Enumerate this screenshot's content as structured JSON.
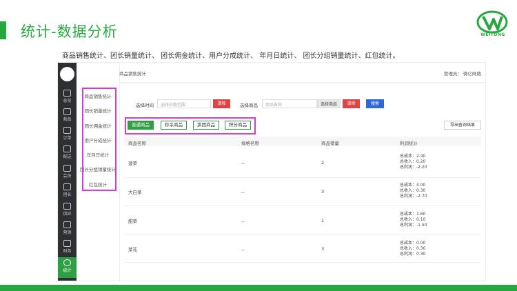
{
  "slide": {
    "title": "统计-数据分析",
    "subtitle": "商品销售统计、团长销量统计、 团长佣金统计、用户分成统计、 年月日统计、 团长分组销量统计、红包统计。",
    "logo_text": "WEITONG"
  },
  "colors": {
    "brand": "#27a83f",
    "highlight": "#d63ad9",
    "nav_bg": "#2d2f33",
    "danger": "#e04343",
    "primary": "#2f68d8"
  },
  "nav": {
    "items": [
      {
        "label": "总览",
        "icon": "home-icon"
      },
      {
        "label": "商品",
        "icon": "goods-icon"
      },
      {
        "label": "订单",
        "icon": "order-icon"
      },
      {
        "label": "配送",
        "icon": "delivery-icon"
      },
      {
        "label": "会员",
        "icon": "member-icon"
      },
      {
        "label": "团长",
        "icon": "leader-icon"
      },
      {
        "label": "供应",
        "icon": "supply-icon"
      },
      {
        "label": "营销",
        "icon": "marketing-icon"
      },
      {
        "label": "财务",
        "icon": "finance-icon"
      },
      {
        "label": "统计",
        "icon": "stats-icon",
        "active": true
      }
    ]
  },
  "subnav": {
    "items": [
      "商品销售统计",
      "团长销量统计",
      "团长佣金统计",
      "用户分成统计",
      "年月日统计",
      "团长分组销量统计",
      "红包统计"
    ]
  },
  "header": {
    "breadcrumb": "商品销售统计",
    "admin": "管理员： 微亿网络"
  },
  "filters": {
    "time_label": "选择时间",
    "time_placeholder": "选择日期范围",
    "clear1": "清除",
    "goods_label": "选择商品",
    "goods_placeholder": "商品名称",
    "select_goods": "选择商品",
    "clear2": "清除",
    "search": "搜索"
  },
  "tabs": [
    "普通商品",
    "秒杀商品",
    "拼团商品",
    "积分商品"
  ],
  "export_label": "导出查询结果",
  "table": {
    "columns": [
      "商品名称",
      "规格名称",
      "商品销量",
      "利润统计"
    ],
    "rows": [
      {
        "name": "菠菜",
        "spec": "--",
        "qty": "2",
        "profit": [
          "总成本：2.40",
          "总收入：0.20",
          "总利润：-2.20"
        ]
      },
      {
        "name": "大白菜",
        "spec": "--",
        "qty": "3",
        "profit": [
          "总成本：3.00",
          "总收入：0.30",
          "总利润：-2.70"
        ]
      },
      {
        "name": "甜菜",
        "spec": "--",
        "qty": "1",
        "profit": [
          "总成本：1.60",
          "总收入：0.10",
          "总利润：-1.50"
        ]
      },
      {
        "name": "菜花",
        "spec": "--",
        "qty": "3",
        "profit": [
          "总成本：0.00",
          "总收入：0.30",
          "总利润：0.30"
        ]
      }
    ]
  }
}
